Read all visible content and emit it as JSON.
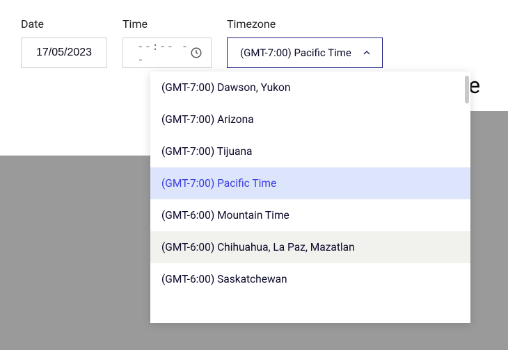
{
  "fields": {
    "date": {
      "label": "Date",
      "value": "17/05/2023"
    },
    "time": {
      "label": "Time",
      "placeholder": "--:-- --"
    },
    "timezone": {
      "label": "Timezone",
      "selected": "(GMT-7:00) Pacific Time"
    }
  },
  "dropdown": {
    "items": [
      {
        "label": "(GMT-7:00) Dawson, Yukon",
        "state": ""
      },
      {
        "label": "(GMT-7:00) Arizona",
        "state": ""
      },
      {
        "label": "(GMT-7:00) Tijuana",
        "state": ""
      },
      {
        "label": "(GMT-7:00) Pacific Time",
        "state": "selected"
      },
      {
        "label": "(GMT-6:00) Mountain Time",
        "state": ""
      },
      {
        "label": "(GMT-6:00) Chihuahua, La Paz, Mazatlan",
        "state": "hovered"
      },
      {
        "label": "(GMT-6:00) Saskatchewan",
        "state": ""
      }
    ]
  },
  "background": {
    "partial_text": "Eve"
  }
}
